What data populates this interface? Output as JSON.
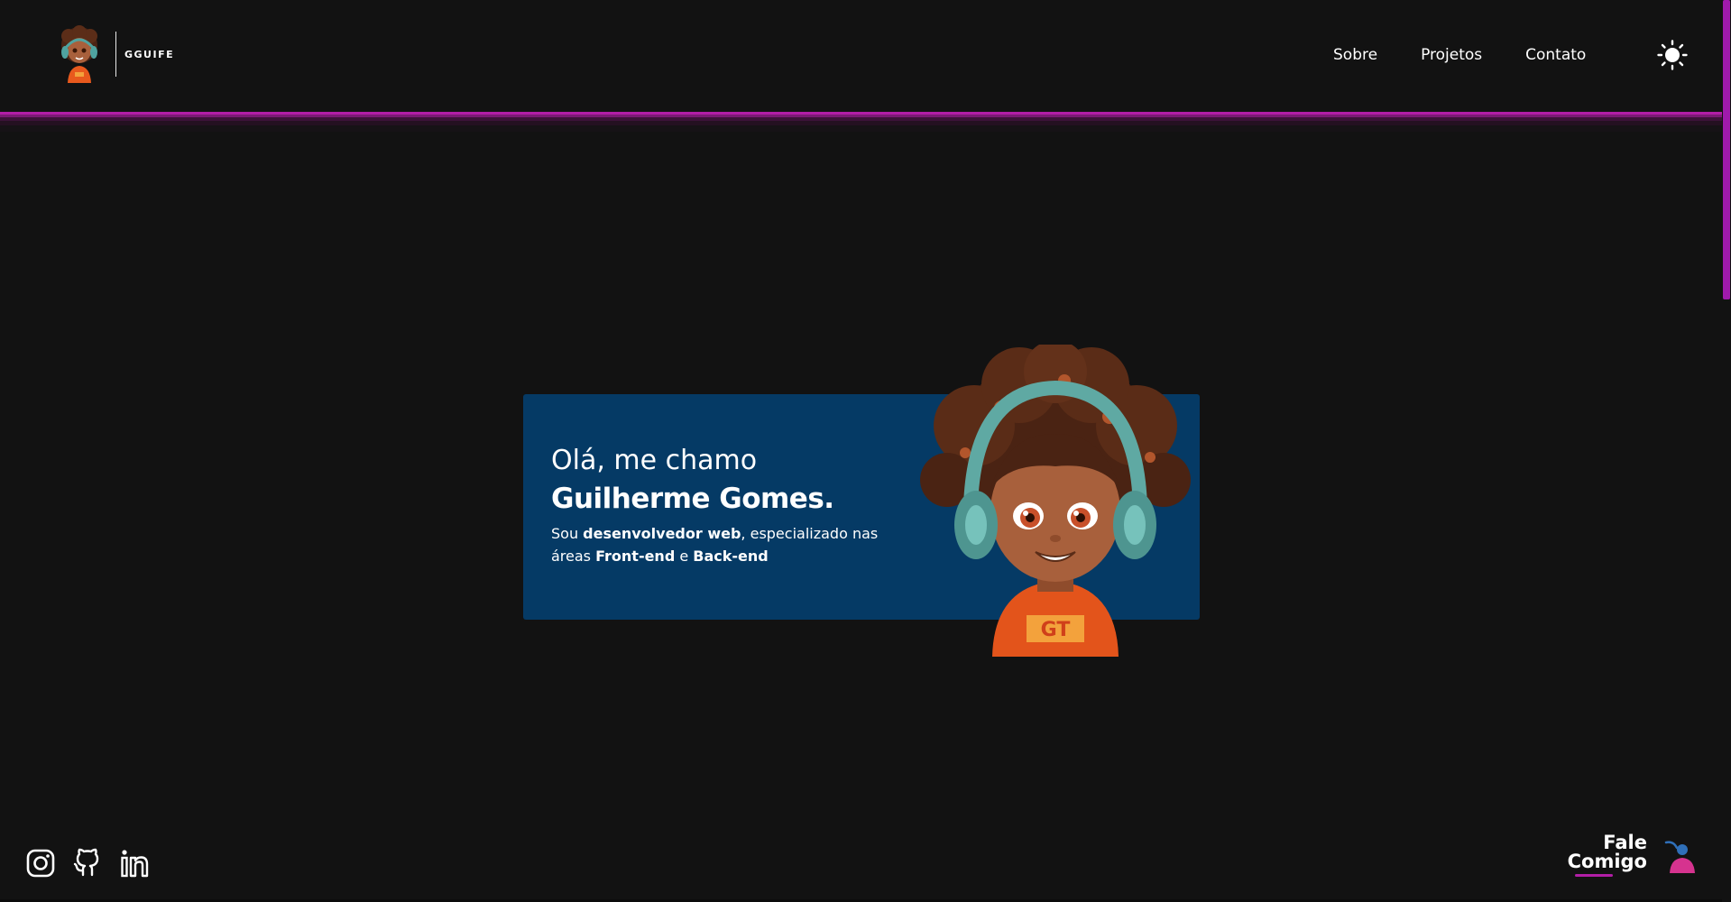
{
  "header": {
    "brand_name": "GGUIFE",
    "nav": [
      {
        "label": "Sobre"
      },
      {
        "label": "Projetos"
      },
      {
        "label": "Contato"
      }
    ],
    "theme_toggle_icon": "sun-icon",
    "accent_color": "#b21ea6"
  },
  "hero": {
    "greeting": "Olá, me chamo",
    "name": "Guilherme Gomes.",
    "intro": {
      "prefix": "Sou ",
      "role": "desenvolvedor web",
      "middle": ", especializado nas áreas ",
      "front": "Front-end",
      "conj": " e ",
      "back": "Back-end"
    },
    "card_color": "#053a65"
  },
  "footer": {
    "socials": [
      {
        "icon": "instagram-icon"
      },
      {
        "icon": "github-icon"
      },
      {
        "icon": "linkedin-icon"
      }
    ],
    "contact_cta": {
      "line1": "Fale",
      "line2": "Comigo",
      "icon": "person-contact-icon"
    }
  },
  "colors": {
    "background": "#121212",
    "scroll_thumb": "#9f1aab"
  }
}
